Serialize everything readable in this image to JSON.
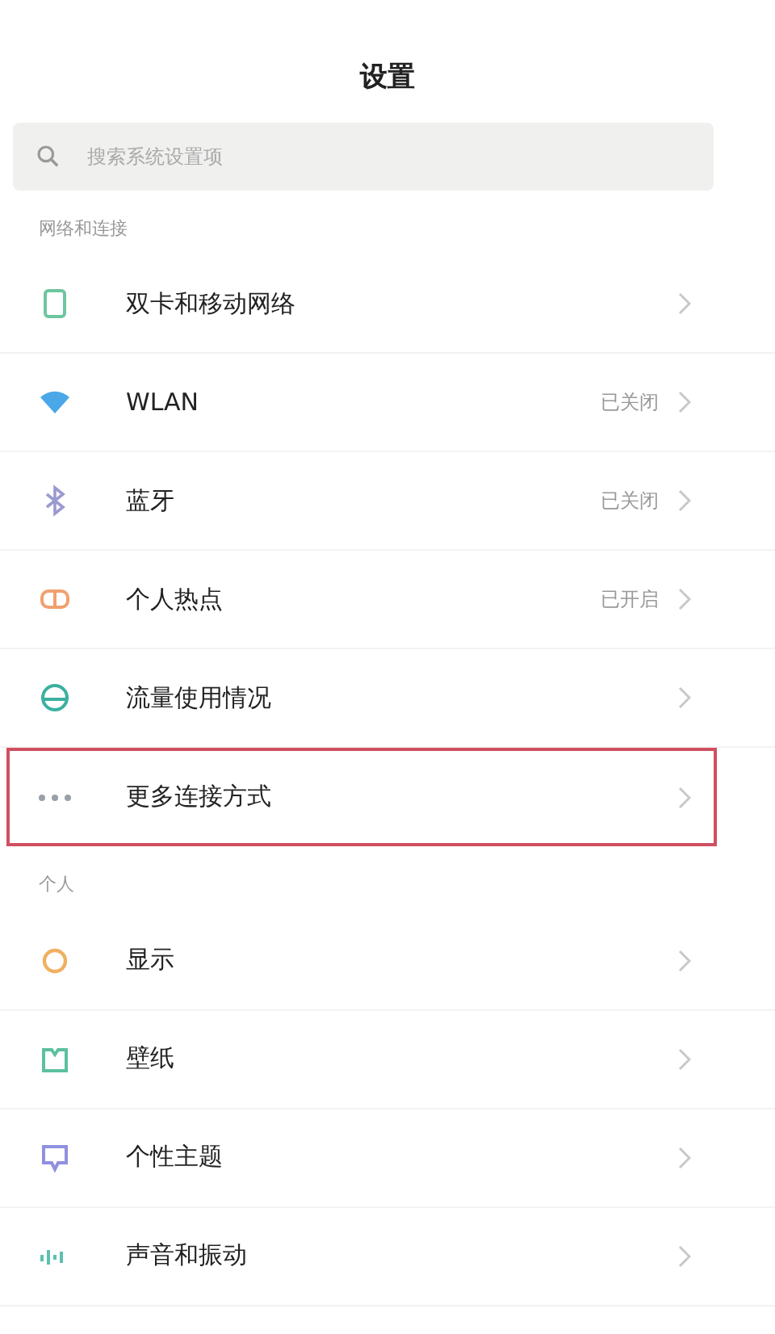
{
  "title": "设置",
  "search": {
    "placeholder": "搜索系统设置项"
  },
  "sections": [
    {
      "header": "网络和连接",
      "items": [
        {
          "kind": "sim",
          "color": "#6cc6a0",
          "label": "双卡和移动网络",
          "highlighted": false
        },
        {
          "kind": "wifi",
          "color": "#4aa8e8",
          "label": "WLAN",
          "value": "已关闭",
          "highlighted": false
        },
        {
          "kind": "bluetooth",
          "color": "#9a9ad0",
          "label": "蓝牙",
          "value": "已关闭",
          "highlighted": false
        },
        {
          "kind": "hotspot",
          "color": "#f0a070",
          "label": "个人热点",
          "value": "已开启",
          "highlighted": false
        },
        {
          "kind": "data",
          "color": "#3cb0a0",
          "label": "流量使用情况",
          "highlighted": false
        },
        {
          "kind": "more",
          "color": "#9aa0a8",
          "label": "更多连接方式",
          "highlighted": true
        }
      ]
    },
    {
      "header": "个人",
      "items": [
        {
          "kind": "display",
          "color": "#f0b060",
          "label": "显示",
          "highlighted": false
        },
        {
          "kind": "wallpaper",
          "color": "#5cc0a0",
          "label": "壁纸",
          "highlighted": false
        },
        {
          "kind": "theme",
          "color": "#9090e0",
          "label": "个性主题",
          "highlighted": false
        },
        {
          "kind": "sound",
          "color": "#5cc0b0",
          "label": "声音和振动",
          "highlighted": false
        }
      ]
    }
  ]
}
